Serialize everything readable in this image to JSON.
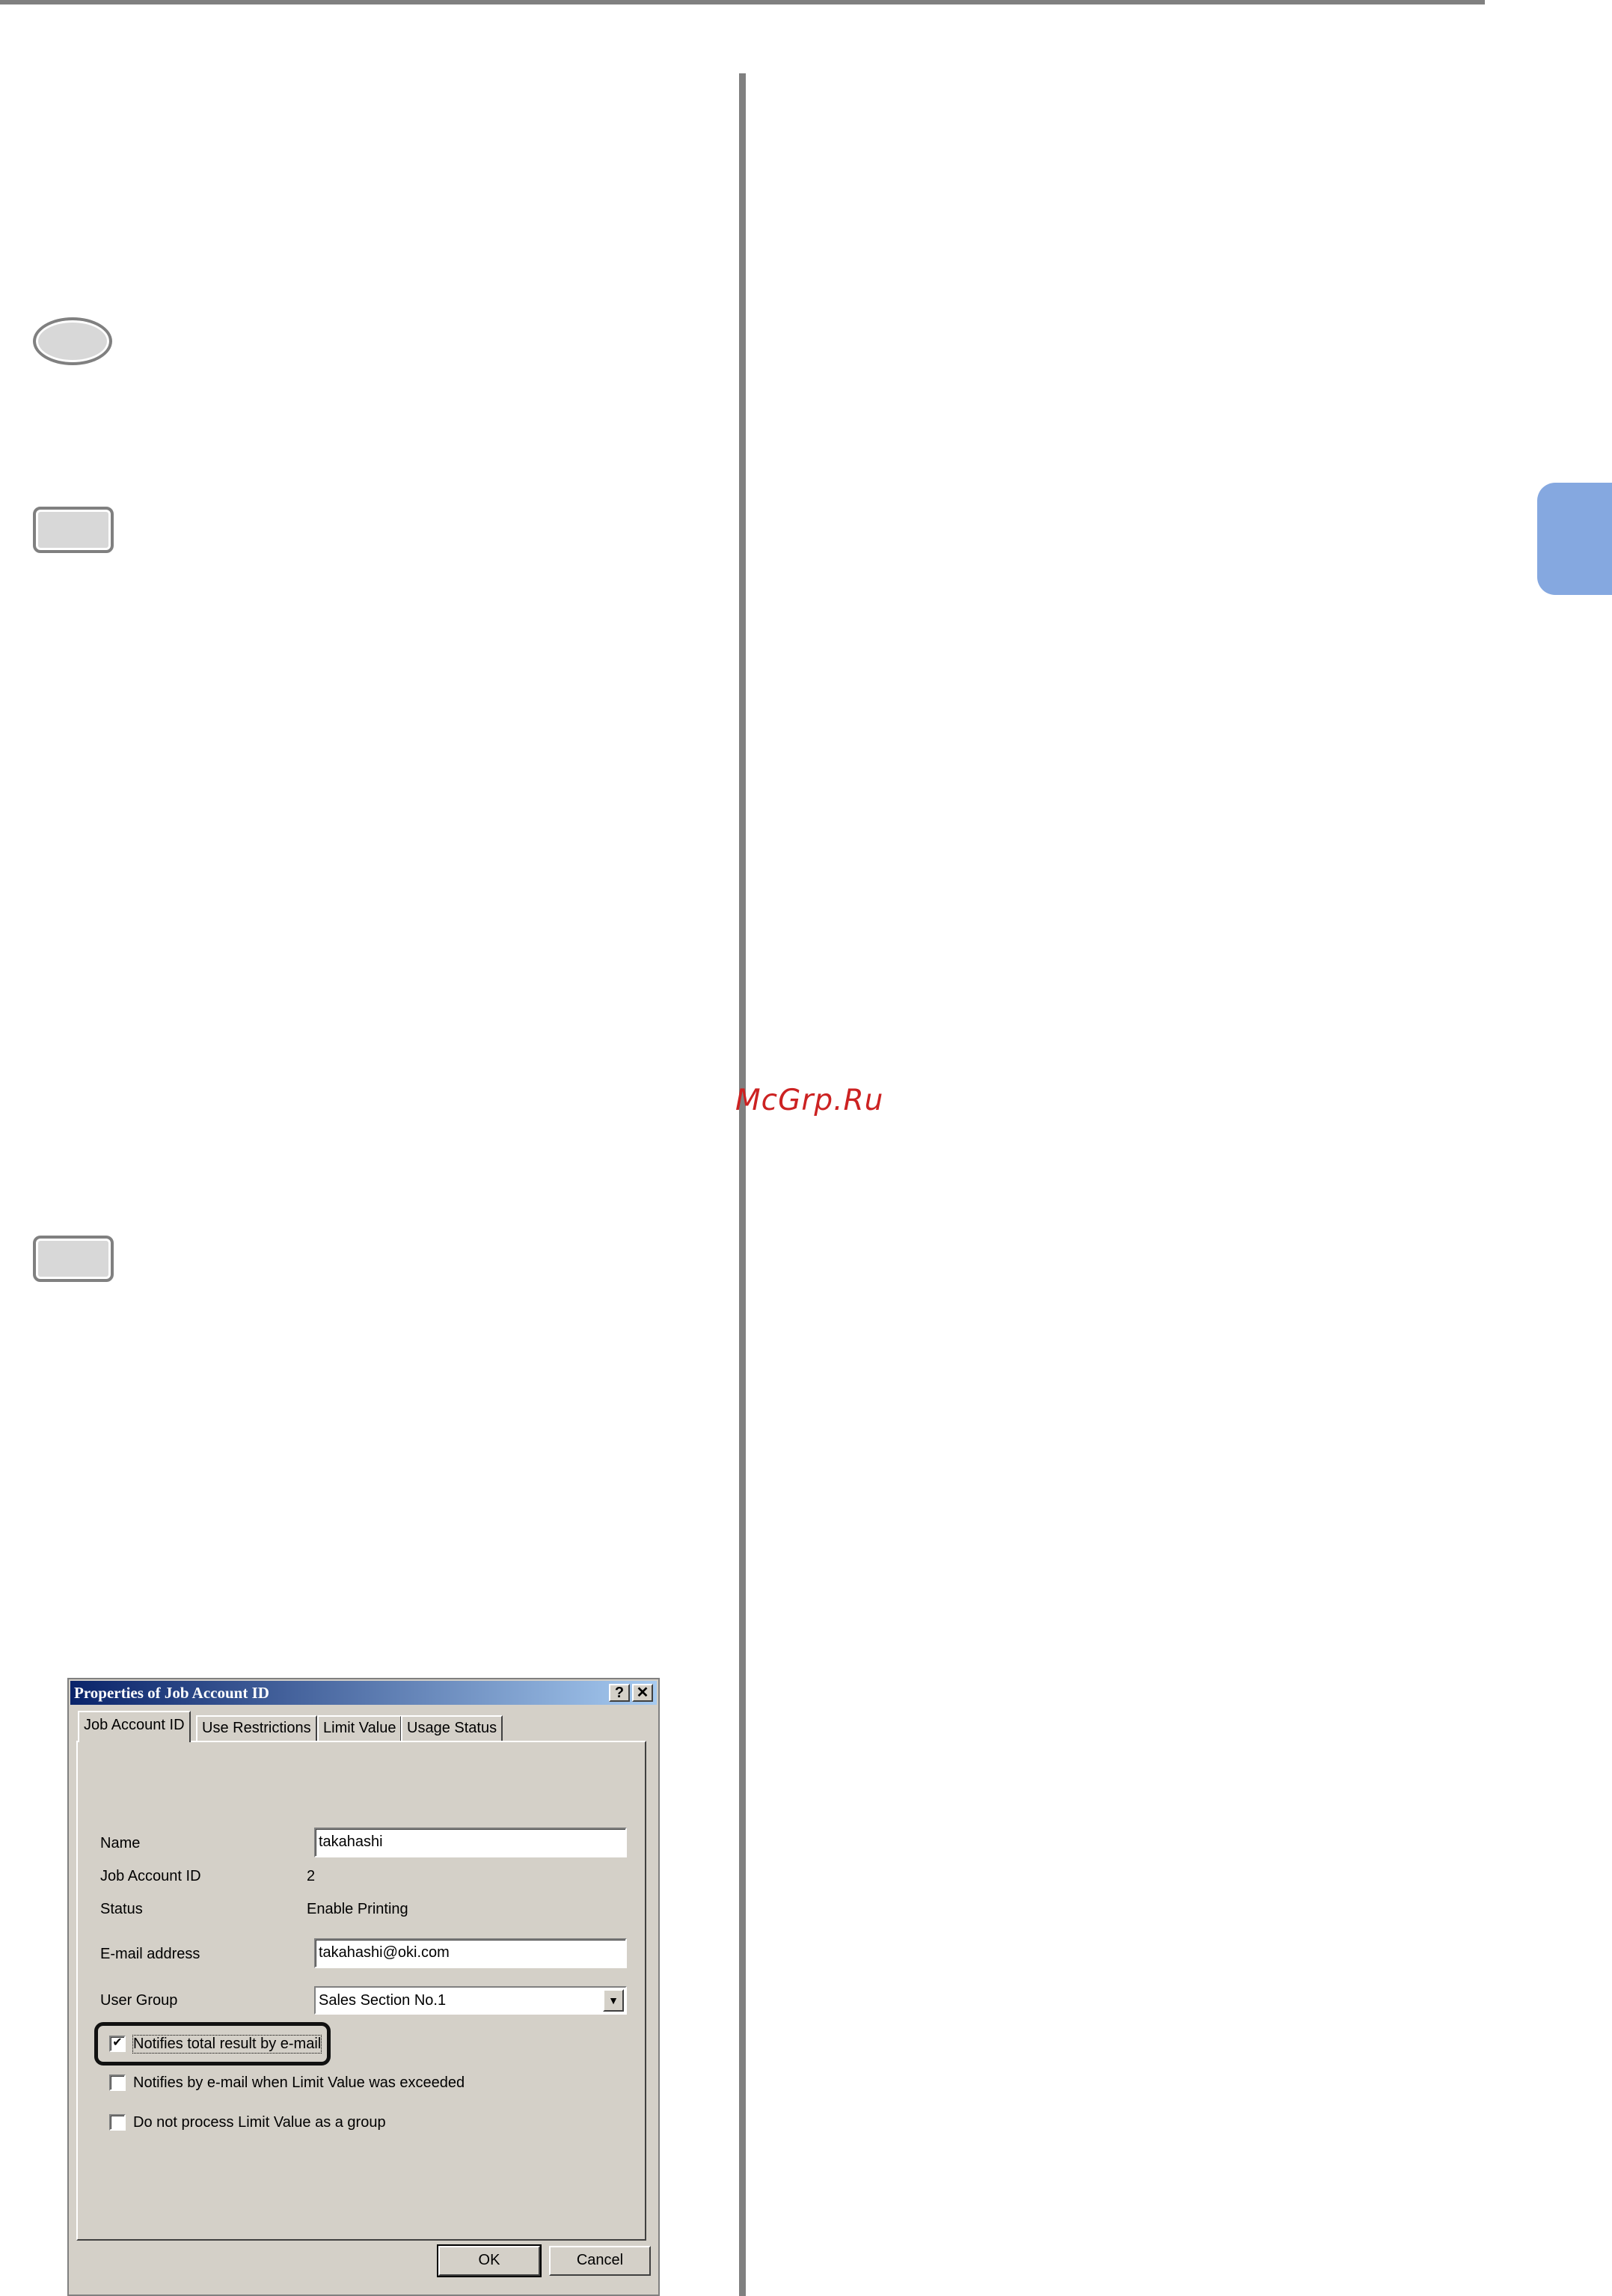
{
  "watermark": "McGrp.Ru",
  "dialog": {
    "title": "Properties of Job Account ID",
    "help_button": "?",
    "close_button": "✕",
    "tabs": [
      {
        "label": "Job Account ID",
        "active": true
      },
      {
        "label": "Use Restrictions",
        "active": false
      },
      {
        "label": "Limit Value",
        "active": false
      },
      {
        "label": "Usage Status",
        "active": false
      }
    ],
    "fields": {
      "name_label": "Name",
      "name_value": "takahashi",
      "job_id_label": "Job Account ID",
      "job_id_value": "2",
      "status_label": "Status",
      "status_value": "Enable Printing",
      "email_label": "E-mail address",
      "email_value": "takahashi@oki.com",
      "group_label": "User Group",
      "group_value": "Sales Section No.1"
    },
    "checkboxes": [
      {
        "label": "Notifies total result by e-mail",
        "checked": true
      },
      {
        "label": "Notifies by e-mail when Limit Value was exceeded",
        "checked": false
      },
      {
        "label": "Do not process Limit Value as a group",
        "checked": false
      }
    ],
    "ok_label": "OK",
    "cancel_label": "Cancel"
  }
}
